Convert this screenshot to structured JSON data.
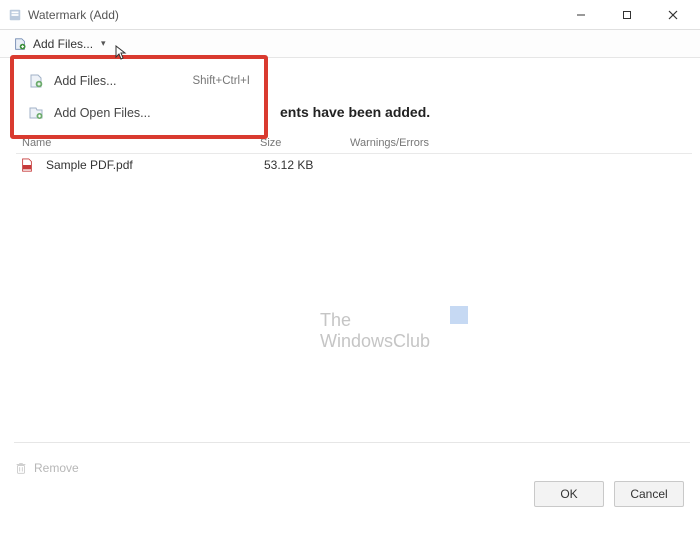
{
  "window": {
    "title": "Watermark (Add)"
  },
  "toolbar": {
    "add_files_label": "Add Files..."
  },
  "dropdown": {
    "items": [
      {
        "label": "Add Files...",
        "shortcut": "Shift+Ctrl+I"
      },
      {
        "label": "Add Open Files..."
      }
    ]
  },
  "instruction_suffix": "ents have been added.",
  "table": {
    "headers": {
      "name": "Name",
      "size": "Size",
      "errors": "Warnings/Errors"
    },
    "rows": [
      {
        "name": "Sample PDF.pdf",
        "size": "53.12 KB",
        "errors": ""
      }
    ]
  },
  "watermark": {
    "line1": "The",
    "line2": "WindowsClub"
  },
  "remove_label": "Remove",
  "buttons": {
    "ok": "OK",
    "cancel": "Cancel"
  }
}
